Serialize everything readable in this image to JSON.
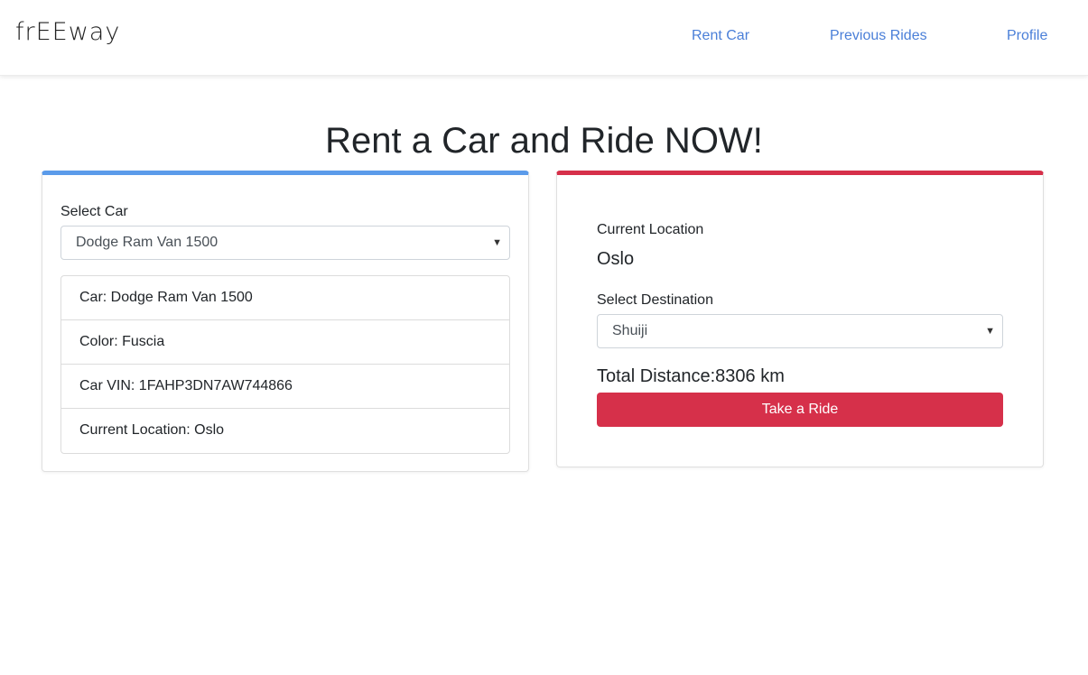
{
  "navbar": {
    "brand": "frEEway",
    "links": [
      "Rent Car",
      "Previous Rides",
      "Profile"
    ]
  },
  "page": {
    "title": "Rent a Car and Ride NOW!"
  },
  "car_panel": {
    "select_label": "Select Car",
    "selected_car": "Dodge Ram Van 1500",
    "details": [
      "Car: Dodge Ram Van 1500",
      "Color: Fuscia",
      "Car VIN: 1FAHP3DN7AW744866",
      "Current Location: Oslo"
    ]
  },
  "ride_panel": {
    "current_location_label": "Current Location",
    "current_location": "Oslo",
    "destination_label": "Select Destination",
    "selected_destination": "Shuiji",
    "total_distance": "Total Distance:8306 km",
    "button_label": "Take a Ride"
  },
  "colors": {
    "accent_blue": "#5b9bea",
    "accent_red": "#d6304a",
    "link": "#4a7fd8"
  }
}
